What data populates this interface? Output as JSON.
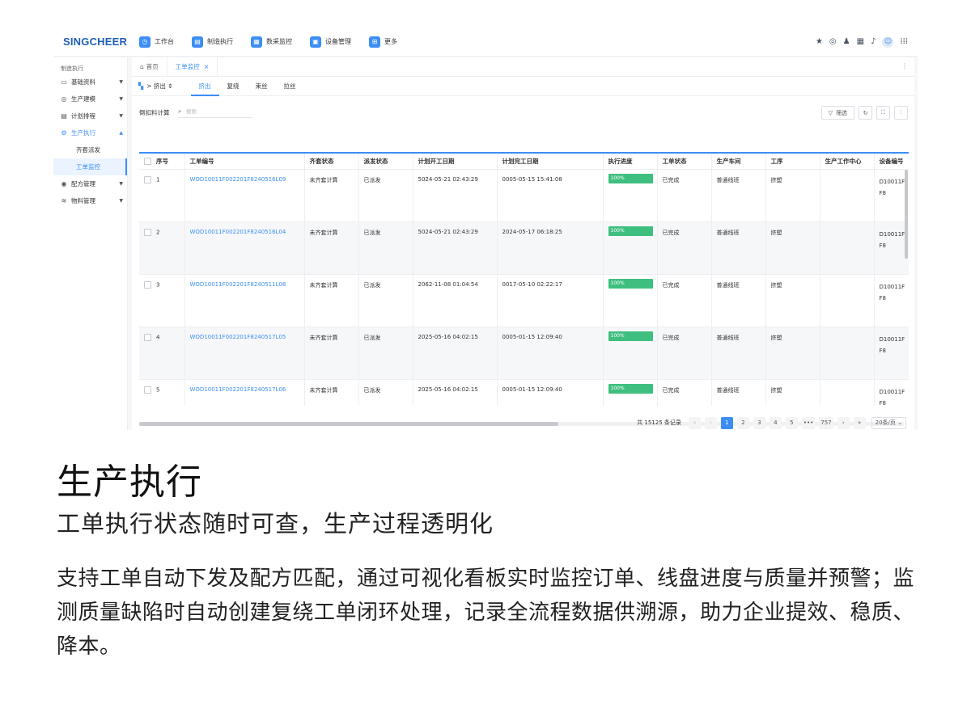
{
  "topbar": {
    "logo": "SINGCHEER",
    "nav": [
      {
        "label": "工作台",
        "icon": "dashboard-icon",
        "glyph": "◷"
      },
      {
        "label": "制造执行",
        "icon": "manufacturing-icon",
        "glyph": "▤"
      },
      {
        "label": "数采监控",
        "icon": "data-monitor-icon",
        "glyph": "▦"
      },
      {
        "label": "设备管理",
        "icon": "equipment-icon",
        "glyph": "▣"
      },
      {
        "label": "更多",
        "icon": "more-apps-icon",
        "glyph": "⊞"
      }
    ]
  },
  "sidebar": {
    "section_title": "制造执行",
    "items": [
      {
        "label": "基础资料",
        "icon": "basic-data-icon",
        "glyph": "▭"
      },
      {
        "label": "生产建模",
        "icon": "modeling-icon",
        "glyph": "◎"
      },
      {
        "label": "计划排程",
        "icon": "schedule-icon",
        "glyph": "▤"
      },
      {
        "label": "生产执行",
        "icon": "execution-icon",
        "glyph": "⚙"
      },
      {
        "label": "配方管理",
        "icon": "recipe-icon",
        "glyph": "◉"
      },
      {
        "label": "物料管理",
        "icon": "material-icon",
        "glyph": "≋"
      }
    ],
    "sub_items": [
      "齐套派发",
      "工单监控"
    ]
  },
  "page_tabs": {
    "home": "首页",
    "active": "工单监控"
  },
  "subnav": {
    "crumb": "挤出",
    "tabs": [
      "挤出",
      "复绕",
      "束丝",
      "拉丝"
    ]
  },
  "toolbar": {
    "label": "倒扣料计算",
    "search_placeholder": "搜索",
    "filter_label": "筛选"
  },
  "table": {
    "headers": [
      "序号",
      "工单编号",
      "齐套状态",
      "派发状态",
      "计划开工日期",
      "计划完工日期",
      "执行进度",
      "工单状态",
      "生产车间",
      "工序",
      "生产工作中心",
      "设备编号"
    ],
    "rows": [
      {
        "no": "1",
        "order": "WOD10011F002201F8240516L09",
        "kit": "未齐套计算",
        "dispatch": "已派发",
        "start": "5024-05-21 02:43:29",
        "end": "0005-05-15 15:41:08",
        "progress": "100%",
        "status": "已完成",
        "workshop": "普通线班",
        "process": "挤塑",
        "center": "",
        "device": "D10011F F8"
      },
      {
        "no": "2",
        "order": "WOD10011F002201F8240516L04",
        "kit": "未齐套计算",
        "dispatch": "已派发",
        "start": "5024-05-21 02:43:29",
        "end": "2024-05-17 06:18:25",
        "progress": "100%",
        "status": "已完成",
        "workshop": "普通线班",
        "process": "挤塑",
        "center": "",
        "device": "D10011F F8"
      },
      {
        "no": "3",
        "order": "WOD10011F002201F8240511L08",
        "kit": "未齐套计算",
        "dispatch": "已派发",
        "start": "2062-11-08 01:04:54",
        "end": "0017-05-10 02:22:17",
        "progress": "100%",
        "status": "已完成",
        "workshop": "普通线班",
        "process": "挤塑",
        "center": "",
        "device": "D10011F F8"
      },
      {
        "no": "4",
        "order": "WOD10011F002201F8240517L05",
        "kit": "未齐套计算",
        "dispatch": "已派发",
        "start": "2025-05-16 04:02:15",
        "end": "0005-01-15 12:09:40",
        "progress": "100%",
        "status": "已完成",
        "workshop": "普通线班",
        "process": "挤塑",
        "center": "",
        "device": "D10011F F8"
      },
      {
        "no": "5",
        "order": "WOD10011F002201F8240517L06",
        "kit": "未齐套计算",
        "dispatch": "已派发",
        "start": "2025-05-16 04:02:15",
        "end": "0005-01-15 12:09:40",
        "progress": "100%",
        "status": "已完成",
        "workshop": "普通线班",
        "process": "挤塑",
        "center": "",
        "device": "D10011F F8"
      }
    ]
  },
  "pagination": {
    "total": "共 15125 条记录",
    "pages": [
      "1",
      "2",
      "3",
      "4",
      "5"
    ],
    "ellipsis": "•••",
    "last": "757",
    "page_size": "20条/页"
  },
  "hero": {
    "title": "生产执行",
    "subtitle": "工单执行状态随时可查，生产过程透明化",
    "description": "支持工单自动下发及配方匹配，通过可视化看板实时监控订单、线盘进度与质量并预警；监测质量缺陷时自动创建复绕工单闭环处理，记录全流程数据供溯源，助力企业提效、稳质、降本。"
  },
  "colors": {
    "accent": "#3c8ef5",
    "progress": "#3fbf7f",
    "logo": "#1f5fb8"
  }
}
